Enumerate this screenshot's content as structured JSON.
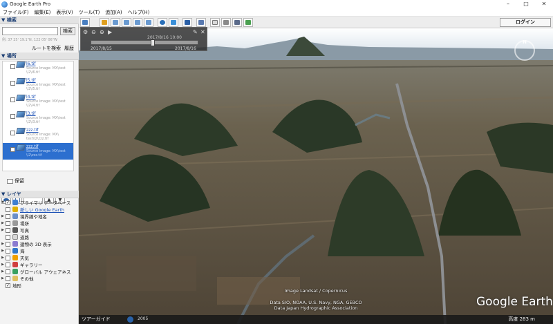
{
  "window": {
    "title": "Google Earth Pro",
    "buttons": [
      "–",
      "□",
      "✕"
    ]
  },
  "menubar": [
    "ファイル(F)",
    "編集(E)",
    "表示(V)",
    "ツール(T)",
    "追加(A)",
    "ヘルプ(H)"
  ],
  "search": {
    "header": "▼ 検索",
    "button": "検索",
    "hint": "例: 37 25' 19.1\"N, 122 05' 06\"W",
    "route_link": "ルートを検索",
    "history_link": "履歴"
  },
  "places": {
    "header": "▼ 場所",
    "items": [
      {
        "name": "l6.tif",
        "sub1": "Source Image: MX\\test",
        "sub2": "\\l2\\l6.tif"
      },
      {
        "name": "l5.tif",
        "sub1": "Source Image: MX\\test",
        "sub2": "\\l2\\l5.tif"
      },
      {
        "name": "l4.tif",
        "sub1": "Source Image: MX\\test",
        "sub2": "\\l2\\l4.tif"
      },
      {
        "name": "l3.tif",
        "sub1": "Source Image: MX\\test",
        "sub2": "\\l2\\l3.tif"
      },
      {
        "name": "zzz.tif",
        "sub1": "Source Image: MX\\",
        "sub2": "test\\l2\\zzz.tif"
      },
      {
        "name": "zzz.tif",
        "sub1": "Source Image: MX\\test",
        "sub2": "\\l2\\zzz.tif",
        "selected": true
      }
    ],
    "storage_folder": "保留"
  },
  "layers": {
    "header": "▼ レイヤ",
    "items": [
      {
        "label": "プライマリ データベース",
        "checked": true,
        "icon_color": "#3f7fd0",
        "expanded": true,
        "link": false
      },
      {
        "label": "新しい Google Earth",
        "checked": false,
        "icon_color": "#e0b000",
        "link": true
      },
      {
        "label": "境界線や地名",
        "checked": false,
        "icon_color": "#6a8fc8",
        "link": false
      },
      {
        "label": "場所",
        "checked": false,
        "icon_color": "#9a9a9a",
        "link": false
      },
      {
        "label": "写真",
        "checked": false,
        "icon_color": "#5a5a5a",
        "link": false
      },
      {
        "label": "道路",
        "checked": false,
        "icon_color": "#d8d8d8",
        "link": false
      },
      {
        "label": "建物の 3D 表示",
        "checked": false,
        "icon_color": "#8a7ad0",
        "link": false
      },
      {
        "label": "海",
        "checked": false,
        "icon_color": "#2f76c9",
        "link": false
      },
      {
        "label": "天気",
        "checked": false,
        "icon_color": "#f0a000",
        "link": false
      },
      {
        "label": "ギャラリー",
        "checked": false,
        "icon_color": "#d04040",
        "link": false
      },
      {
        "label": "グローバル アウェアネス",
        "checked": false,
        "icon_color": "#3aa060",
        "link": false
      },
      {
        "label": "その他",
        "checked": false,
        "icon_color": "#e0c060",
        "link": false
      },
      {
        "label": "地形",
        "checked": true,
        "icon_color": "#7a6040",
        "link": false
      }
    ]
  },
  "toolbar": {
    "login": "ログイン",
    "button_icons": [
      "sidebar-icon",
      "placemark-icon",
      "polygon-icon",
      "path-icon",
      "overlay-icon",
      "tour-icon",
      "history-icon",
      "sun-icon",
      "planets-icon",
      "ruler-icon",
      "email-icon",
      "print-icon",
      "save-image-icon",
      "maps-icon"
    ]
  },
  "timebar": {
    "current": "2017/8/16  10:00",
    "start": "2017/8/15",
    "end": "2017/8/16",
    "position": 0.58
  },
  "viewport": {
    "credits": [
      "Image Landsat / Copernicus",
      "Data SIO, NOAA, U.S. Navy, NGA, GEBCO",
      "Data Japan Hydrographic Association"
    ],
    "logo": "Google Earth",
    "tour_button": "ツアーガイド",
    "year_label": "2005",
    "altitude": "高度  283 m"
  }
}
